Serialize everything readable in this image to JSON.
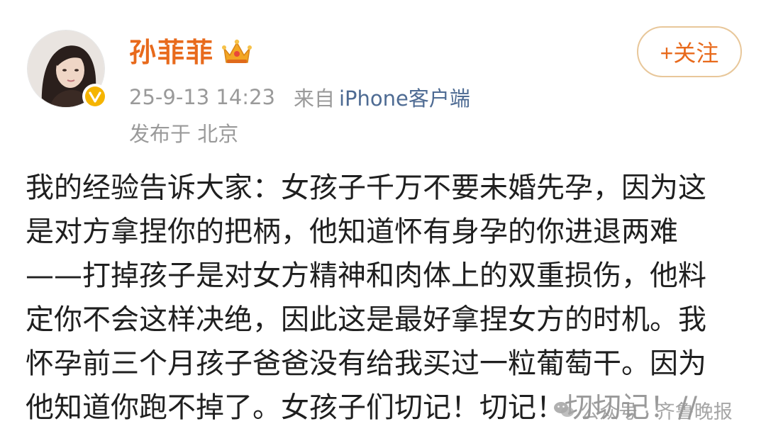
{
  "user": {
    "name": "孙菲菲",
    "badge_icon": "crown-icon",
    "verified_icon": "verified-v-icon",
    "avatar_icon": "avatar-photo"
  },
  "meta": {
    "time": "25-9-13 14:23",
    "source_prefix": "来自",
    "source": "iPhone客户端",
    "location": "发布于 北京"
  },
  "follow_button": {
    "label": "+关注"
  },
  "post": {
    "lines": [
      "我的经验告诉大家：女孩子千万不要未婚先孕，因为这",
      "是对方拿捏你的把柄，他知道怀有身孕的你进退两难",
      "——打掉孩子是对女方精神和肉体上的双重损伤，他料",
      "定你不会这样决绝，因此这是最好拿捏女方的时机。我",
      "怀孕前三个月孩子爸爸没有给我买过一粒葡萄干。因为",
      "他知道你跑不掉了。女孩子们切记！切记！切切记！//"
    ]
  },
  "watermark": {
    "icon": "wechat-icon",
    "text": "公众号 · 齐鲁晚报"
  },
  "colors": {
    "username": "#e86a1c",
    "follow_border": "#e8c79a",
    "source_link": "#4e6b93",
    "meta_text": "#9a9a9a",
    "verified_badge": "#f5b400"
  }
}
